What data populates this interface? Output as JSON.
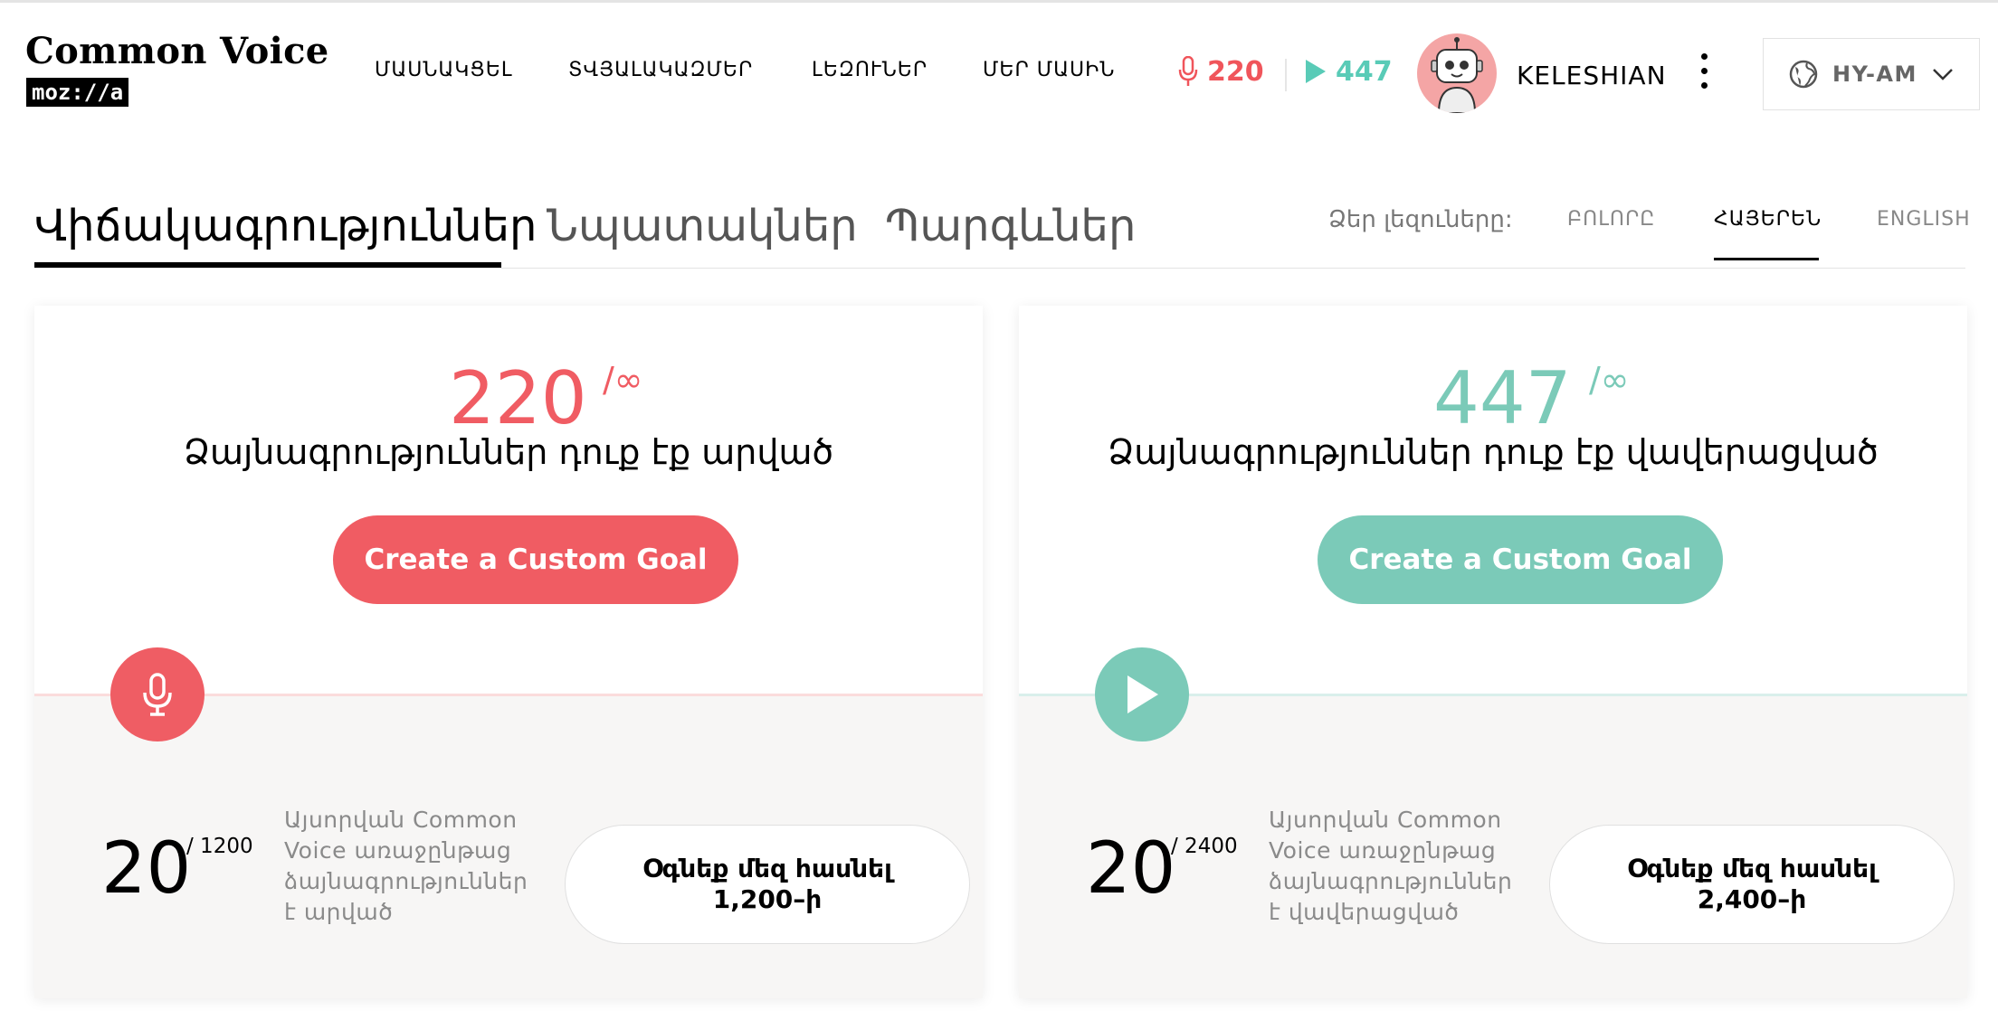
{
  "brand": {
    "title": "Common Voice",
    "mozilla": "moz://a"
  },
  "nav": {
    "items": [
      "ՄԱՍՆԱԿՑԵԼ",
      "ՏՎՅԱԼԱԿԱԶՄԵՐ",
      "ԼԵԶՈՒՆԵՐ",
      "ՄԵՐ ՄԱՍԻՆ"
    ]
  },
  "user": {
    "recordings": "220",
    "validations": "447",
    "name": "KELESHIAN",
    "language": "HY-AM"
  },
  "tabs": [
    "Վիճակագրություններ",
    "Նպատակներ",
    "Պարգևներ"
  ],
  "language_filter": {
    "label": "Ձեր լեզուները:",
    "options": [
      "ԲՈԼՈՐԸ",
      "ՀԱՅԵՐԵՆ",
      "ENGLISH"
    ],
    "selected": "ՀԱՅԵՐԵՆ"
  },
  "cards": {
    "record": {
      "count": "220",
      "goal": "/∞",
      "description": "Ձայնագրություններ դուք էք արված",
      "button": "Create a Custom Goal",
      "today_count": "20",
      "today_total": "/ 1200",
      "today_desc": "Այսորվան Common Voice առաջընթաց ձայնագրություններ է արված",
      "help_line1": "Օգնեք մեզ հասնել",
      "help_line2": "1,200–ի"
    },
    "validate": {
      "count": "447",
      "goal": "/∞",
      "description": "Ձայնագրություններ դուք էք վավերացված",
      "button": "Create a Custom Goal",
      "today_count": "20",
      "today_total": "/ 2400",
      "today_desc": "Այսորվան Common Voice առաջընթաց ձայնագրություններ է վավերացված",
      "help_line1": "Օգնեք մեզ հասնել",
      "help_line2": "2,400–ի"
    }
  },
  "colors": {
    "record_accent": "#f05c63",
    "validate_accent": "#7bcab8"
  },
  "icons": [
    "microphone-icon",
    "play-icon",
    "globe-icon",
    "chevron-down-icon",
    "more-vertical-icon"
  ]
}
